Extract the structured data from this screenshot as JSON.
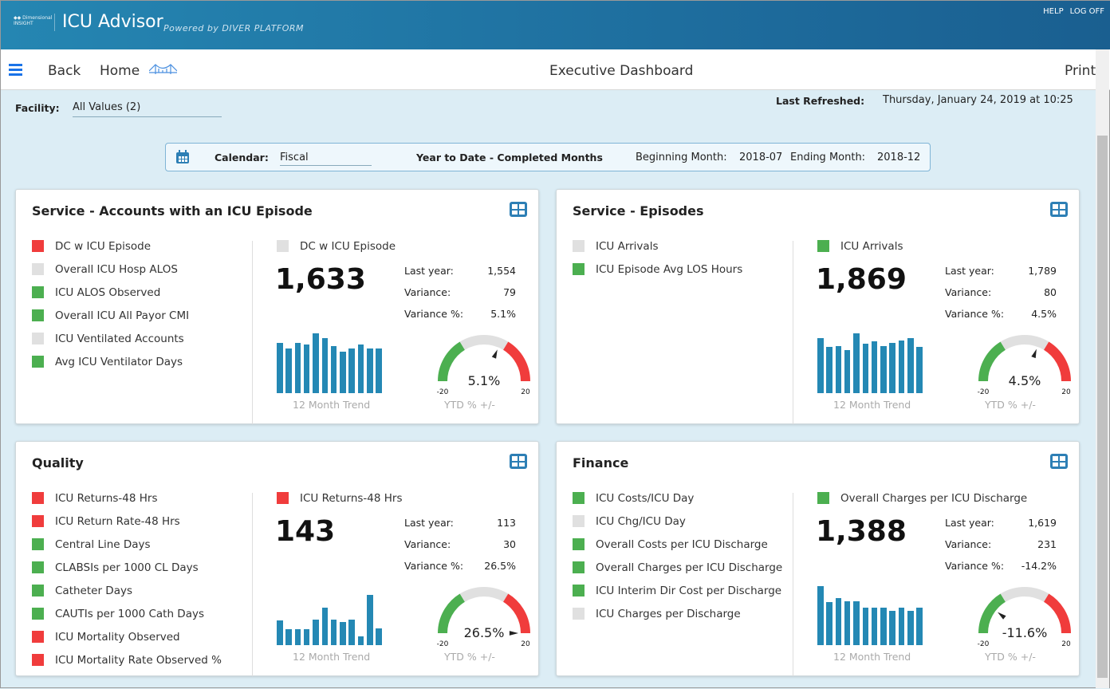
{
  "header": {
    "logo_text": "Dimensional Insight",
    "app_title": "ICU Advisor",
    "powered_by": "Powered by DIVER PLATFORM",
    "links": [
      "HELP",
      "LOG OFF"
    ]
  },
  "nav": {
    "back": "Back",
    "home": "Home",
    "page_title": "Executive Dashboard",
    "print": "Print"
  },
  "filters": {
    "facility_label": "Facility:",
    "facility_value": "All Values (2)",
    "last_refreshed_label": "Last Refreshed:",
    "last_refreshed_value": "Thursday, January 24, 2019 at 10:25"
  },
  "calendar": {
    "label": "Calendar:",
    "value": "Fiscal",
    "period": "Year to Date - Completed Months",
    "begin_label": "Beginning Month:",
    "begin_value": "2018-07",
    "end_label": "Ending Month:",
    "end_value": "2018-12"
  },
  "colors": {
    "red": "#f03c3c",
    "green": "#4caf50",
    "gray": "#e0e0e0",
    "bar": "#2488b4"
  },
  "cards": [
    {
      "title": "Service - Accounts with an ICU Episode",
      "metrics": [
        {
          "label": "DC w ICU Episode",
          "status": "red"
        },
        {
          "label": "Overall ICU Hosp ALOS",
          "status": "gray"
        },
        {
          "label": "ICU ALOS Observed",
          "status": "green"
        },
        {
          "label": "Overall ICU All Payor CMI",
          "status": "green"
        },
        {
          "label": "ICU Ventilated Accounts",
          "status": "gray"
        },
        {
          "label": "Avg ICU Ventilator Days",
          "status": "green"
        }
      ],
      "selected": {
        "label": "DC w ICU Episode",
        "status": "gray"
      },
      "value": "1,633",
      "last_year_label": "Last year:",
      "last_year": "1,554",
      "variance_label": "Variance:",
      "variance": "79",
      "variance_pct_label": "Variance %:",
      "variance_pct": "5.1%",
      "trend": [
        63,
        56,
        63,
        61,
        75,
        69,
        59,
        52,
        56,
        61,
        56,
        56
      ],
      "trend_label": "12 Month Trend",
      "gauge": {
        "value": 5.1,
        "display": "5.1%",
        "min": "-20",
        "max": "20",
        "label": "YTD % +/-"
      }
    },
    {
      "title": "Service - Episodes",
      "metrics": [
        {
          "label": "ICU Arrivals",
          "status": "gray"
        },
        {
          "label": "ICU Episode Avg LOS Hours",
          "status": "green"
        }
      ],
      "selected": {
        "label": "ICU Arrivals",
        "status": "green"
      },
      "value": "1,869",
      "last_year_label": "Last year:",
      "last_year": "1,789",
      "variance_label": "Variance:",
      "variance": "80",
      "variance_pct_label": "Variance %:",
      "variance_pct": "4.5%",
      "trend": [
        69,
        58,
        59,
        54,
        75,
        62,
        65,
        59,
        63,
        66,
        69,
        58
      ],
      "trend_label": "12 Month Trend",
      "gauge": {
        "value": 4.5,
        "display": "4.5%",
        "min": "-20",
        "max": "20",
        "label": "YTD % +/-"
      }
    },
    {
      "title": "Quality",
      "metrics": [
        {
          "label": "ICU Returns-48 Hrs",
          "status": "red"
        },
        {
          "label": "ICU Return Rate-48 Hrs",
          "status": "red"
        },
        {
          "label": "Central Line Days",
          "status": "green"
        },
        {
          "label": "CLABSIs per 1000 CL Days",
          "status": "green"
        },
        {
          "label": "Catheter Days",
          "status": "green"
        },
        {
          "label": "CAUTIs per 1000 Cath Days",
          "status": "green"
        },
        {
          "label": "ICU Mortality Observed",
          "status": "red"
        },
        {
          "label": "ICU Mortality Rate Observed %",
          "status": "red"
        }
      ],
      "selected": {
        "label": "ICU Returns-48 Hrs",
        "status": "red"
      },
      "value": "143",
      "last_year_label": "Last year:",
      "last_year": "113",
      "variance_label": "Variance:",
      "variance": "30",
      "variance_pct_label": "Variance %:",
      "variance_pct": "26.5%",
      "trend": [
        31,
        20,
        20,
        20,
        32,
        47,
        32,
        29,
        32,
        11,
        63,
        21
      ],
      "trend_label": "12 Month Trend",
      "gauge": {
        "value": 26.5,
        "display": "26.5%",
        "min": "-20",
        "max": "20",
        "label": "YTD % +/-"
      }
    },
    {
      "title": "Finance",
      "metrics": [
        {
          "label": "ICU Costs/ICU Day",
          "status": "green"
        },
        {
          "label": "ICU Chg/ICU Day",
          "status": "gray"
        },
        {
          "label": "Overall Costs per ICU Discharge",
          "status": "green"
        },
        {
          "label": "Overall Charges per ICU Discharge",
          "status": "green"
        },
        {
          "label": "ICU Interim Dir Cost per Discharge",
          "status": "green"
        },
        {
          "label": "ICU Charges per Discharge",
          "status": "gray"
        }
      ],
      "selected": {
        "label": "Overall Charges per ICU Discharge",
        "status": "green"
      },
      "value": "1,388",
      "last_year_label": "Last year:",
      "last_year": "1,619",
      "variance_label": "Variance:",
      "variance": "231",
      "variance_pct_label": "Variance %:",
      "variance_pct": "-14.2%",
      "trend": [
        74,
        54,
        59,
        55,
        55,
        47,
        47,
        47,
        43,
        47,
        43,
        47
      ],
      "trend_label": "12 Month Trend",
      "gauge": {
        "value": -11.6,
        "display": "-11.6%",
        "min": "-20",
        "max": "20",
        "label": "YTD % +/-"
      }
    }
  ]
}
